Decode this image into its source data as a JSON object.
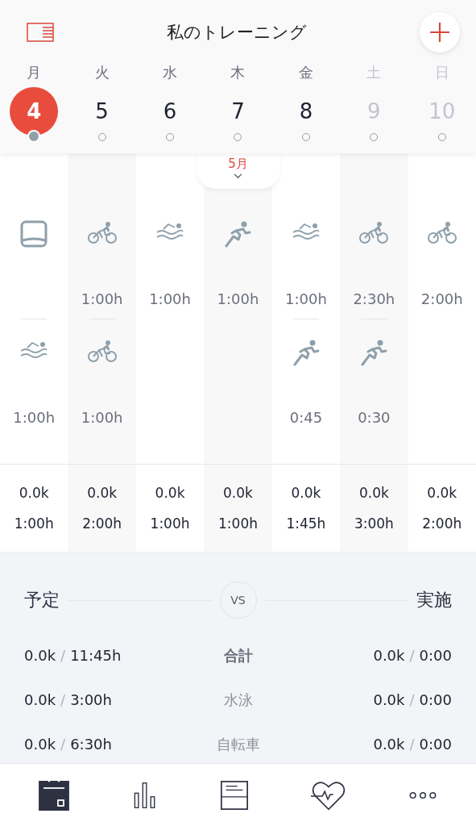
{
  "header": {
    "title": "私のトレーニング"
  },
  "month": "5月",
  "days": [
    {
      "weekday": "月",
      "date": "4",
      "selected": true,
      "weekend": false,
      "sessions": [
        {
          "kind": "rest"
        },
        {
          "kind": "swim",
          "duration": "1:00h"
        }
      ],
      "total_distance": "0.0k",
      "total_time": "1:00h"
    },
    {
      "weekday": "火",
      "date": "5",
      "selected": false,
      "weekend": false,
      "sessions": [
        {
          "kind": "bike",
          "duration": "1:00h"
        },
        {
          "kind": "bike",
          "duration": "1:00h"
        }
      ],
      "total_distance": "0.0k",
      "total_time": "2:00h"
    },
    {
      "weekday": "水",
      "date": "6",
      "selected": false,
      "weekend": false,
      "sessions": [
        {
          "kind": "swim",
          "duration": "1:00h"
        }
      ],
      "total_distance": "0.0k",
      "total_time": "1:00h"
    },
    {
      "weekday": "木",
      "date": "7",
      "selected": false,
      "weekend": false,
      "sessions": [
        {
          "kind": "run",
          "duration": "1:00h"
        }
      ],
      "total_distance": "0.0k",
      "total_time": "1:00h"
    },
    {
      "weekday": "金",
      "date": "8",
      "selected": false,
      "weekend": false,
      "sessions": [
        {
          "kind": "swim",
          "duration": "1:00h"
        },
        {
          "kind": "run",
          "duration": "0:45"
        }
      ],
      "total_distance": "0.0k",
      "total_time": "1:45h"
    },
    {
      "weekday": "土",
      "date": "9",
      "selected": false,
      "weekend": true,
      "sessions": [
        {
          "kind": "bike",
          "duration": "2:30h"
        },
        {
          "kind": "run",
          "duration": "0:30"
        }
      ],
      "total_distance": "0.0k",
      "total_time": "3:00h"
    },
    {
      "weekday": "日",
      "date": "10",
      "selected": false,
      "weekend": true,
      "sessions": [
        {
          "kind": "bike",
          "duration": "2:00h"
        }
      ],
      "total_distance": "0.0k",
      "total_time": "2:00h"
    }
  ],
  "compare": {
    "plan_label": "予定",
    "vs": "VS",
    "actual_label": "実施",
    "rows": [
      {
        "kind": "total",
        "label": "合計",
        "plan": {
          "distance": "0.0k",
          "sep": "/",
          "time": "11:45h"
        },
        "actual": {
          "distance": "0.0k",
          "sep": "/",
          "time": "0:00"
        }
      },
      {
        "kind": "sport",
        "label": "水泳",
        "plan": {
          "distance": "0.0k",
          "sep": "/",
          "time": "3:00h"
        },
        "actual": {
          "distance": "0.0k",
          "sep": "/",
          "time": "0:00"
        }
      },
      {
        "kind": "sport",
        "label": "自転車",
        "plan": {
          "distance": "0.0k",
          "sep": "/",
          "time": "6:30h"
        },
        "actual": {
          "distance": "0.0k",
          "sep": "/",
          "time": "0:00"
        }
      }
    ]
  },
  "nav": [
    {
      "kind": "calendar",
      "selected": true
    },
    {
      "kind": "stats",
      "selected": false
    },
    {
      "kind": "log",
      "selected": false
    },
    {
      "kind": "health",
      "selected": false
    },
    {
      "kind": "more",
      "selected": false
    }
  ]
}
